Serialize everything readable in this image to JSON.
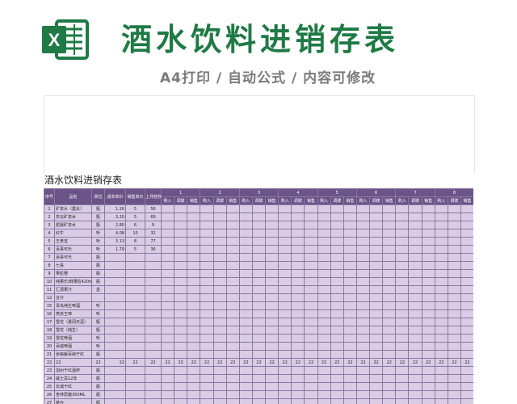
{
  "banner": {
    "logo_letter": "X",
    "title": "酒水饮料进销存表",
    "subtitle": "A4打印 / 自动公式 / 内容可修改"
  },
  "sheet": {
    "title": "酒水饮料进销存表",
    "header": {
      "no": "序号",
      "name": "品名",
      "unit": "单位",
      "cost": "成本单价",
      "price": "销售单价",
      "stock": "上月结存",
      "days": [
        "1",
        "2",
        "3",
        "4",
        "5",
        "6",
        "7",
        "8"
      ],
      "sub": [
        "购入",
        "调拨",
        "销售"
      ]
    },
    "rows": [
      [
        "1",
        "矿泉水（農夫）",
        "瓶",
        "1.26",
        "5",
        "56"
      ],
      [
        "2",
        "农云矿泉水",
        "瓶",
        "3.20",
        "5",
        "69"
      ],
      [
        "3",
        "碧晨矿泉水",
        "瓶",
        "2.80",
        "6",
        "9"
      ],
      [
        "4",
        "红牛",
        "听",
        "4.08",
        "10",
        "32"
      ],
      [
        "5",
        "王老吉",
        "听",
        "3.13",
        "8",
        "77"
      ],
      [
        "6",
        "百事可乐",
        "听",
        "1.79",
        "5",
        "36"
      ],
      [
        "7",
        "百事可乐",
        "瓶",
        "",
        "",
        ""
      ],
      [
        "8",
        "七喜",
        "瓶",
        "",
        "",
        ""
      ],
      [
        "9",
        "果粒橙",
        "瓶",
        "",
        "",
        ""
      ],
      [
        "10",
        "纯果乐/鲜果粒420ml",
        "瓶",
        "",
        "",
        ""
      ],
      [
        "11",
        "汇源果汁",
        "盒",
        "",
        "",
        ""
      ],
      [
        "12",
        "合计",
        "",
        "",
        "",
        ""
      ],
      [
        "15",
        "青岛纯生啤酒",
        "听",
        "",
        "",
        ""
      ],
      [
        "16",
        "燕京王啤",
        "听",
        "",
        "",
        ""
      ],
      [
        "17",
        "雪花（勇闯天涯）",
        "瓶",
        "",
        "",
        ""
      ],
      [
        "18",
        "雪花（纯生）",
        "瓶",
        "",
        "",
        ""
      ],
      [
        "19",
        "雪花啤酒",
        "听",
        "",
        "",
        ""
      ],
      [
        "20",
        "百威啤酒",
        "听",
        "",
        "",
        ""
      ],
      [
        "21",
        "张裕解百纳干红",
        "瓶",
        "",
        "",
        ""
      ],
      [
        "22",
        "22",
        "22",
        "22",
        "22",
        "22"
      ],
      [
        "23",
        "加州干红酒杯",
        "瓶",
        "",
        "",
        ""
      ],
      [
        "24",
        "威士忌12年",
        "瓶",
        "",
        "",
        ""
      ],
      [
        "25",
        "长城干红",
        "瓶",
        "",
        "",
        ""
      ],
      [
        "26",
        "杏林原酱350ML",
        "瓶",
        "",
        "",
        ""
      ],
      [
        "27",
        "茅台",
        "瓶",
        "",
        "",
        ""
      ]
    ],
    "fill_value": "22"
  }
}
